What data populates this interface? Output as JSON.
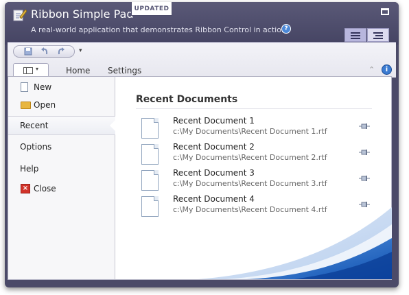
{
  "window": {
    "title": "Ribbon Simple Pad",
    "badge": "UPDATED",
    "subtitle": "A real-world application that demonstrates Ribbon Control in action.",
    "icons": {
      "app": "notepad-pen-icon",
      "help": "question-icon",
      "maximize": "maximize-icon",
      "layout_options": [
        "ribbon-layout-icon",
        "ribbon-layout-alt-icon"
      ]
    }
  },
  "ribbon": {
    "quick_access": [
      "save-icon",
      "undo-icon",
      "redo-icon"
    ],
    "qat_dropdown": "▾",
    "app_menu_arrow": "▾",
    "tabs": [
      {
        "label": "Home"
      },
      {
        "label": "Settings"
      }
    ],
    "collapse_glyph": "⌃",
    "help_glyph": "i"
  },
  "backstage": {
    "nav": [
      {
        "label": "New",
        "icon": "new-document-icon"
      },
      {
        "label": "Open",
        "icon": "folder-icon"
      },
      {
        "label": "Recent",
        "selected": true
      },
      {
        "label": "Options"
      },
      {
        "label": "Help"
      },
      {
        "label": "Close",
        "icon": "close-icon"
      }
    ],
    "recent": {
      "title": "Recent Documents",
      "items": [
        {
          "name": "Recent Document 1",
          "path": "c:\\My Documents\\Recent Document 1.rtf"
        },
        {
          "name": "Recent Document 2",
          "path": "c:\\My Documents\\Recent Document 2.rtf"
        },
        {
          "name": "Recent Document 3",
          "path": "c:\\My Documents\\Recent Document 3.rtf"
        },
        {
          "name": "Recent Document 4",
          "path": "c:\\My Documents\\Recent Document 4.rtf"
        }
      ]
    }
  },
  "colors": {
    "title_bar": "#4b4a68",
    "accent_swoosh": "#1e64c8",
    "close_red": "#d1332a"
  }
}
